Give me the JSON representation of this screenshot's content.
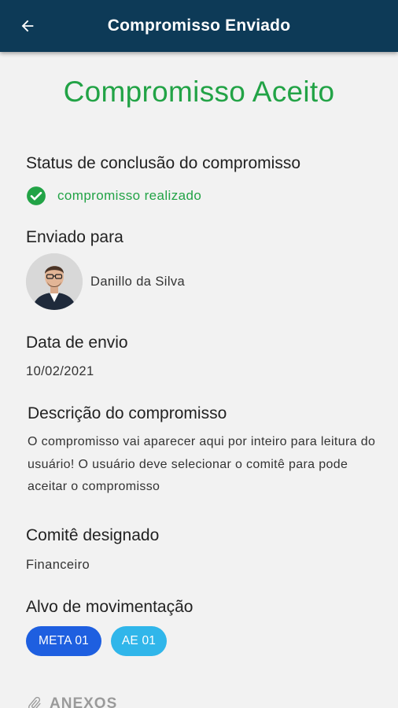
{
  "header": {
    "title": "Compromisso Enviado",
    "back_icon": "arrow-left-icon"
  },
  "main": {
    "headline": "Compromisso Aceito",
    "headline_color": "#22a346",
    "status_section": {
      "title": "Status de conclusão do compromisso",
      "value": "compromisso realizado",
      "icon": "check-circle-icon"
    },
    "recipient_section": {
      "title": "Enviado para",
      "name": "Danillo da Silva"
    },
    "date_section": {
      "title": "Data de envio",
      "value": "10/02/2021"
    },
    "description_section": {
      "title": "Descrição do compromisso",
      "text": "O compromisso vai aparecer aqui por inteiro para leitura do usuário! O usuário deve selecionar o comitê para pode aceitar o compromisso"
    },
    "committee_section": {
      "title": "Comitê designado",
      "value": "Financeiro"
    },
    "target_section": {
      "title": "Alvo de movimentação",
      "chips": [
        {
          "label": "META 01",
          "color": "#1e5fe0"
        },
        {
          "label": "AE 01",
          "color": "#30b6ea"
        }
      ]
    },
    "attachments": {
      "label": "ANEXOS",
      "icon": "paperclip-icon"
    }
  },
  "colors": {
    "app_bar": "#0d3a57",
    "background": "#f2f2f2"
  }
}
